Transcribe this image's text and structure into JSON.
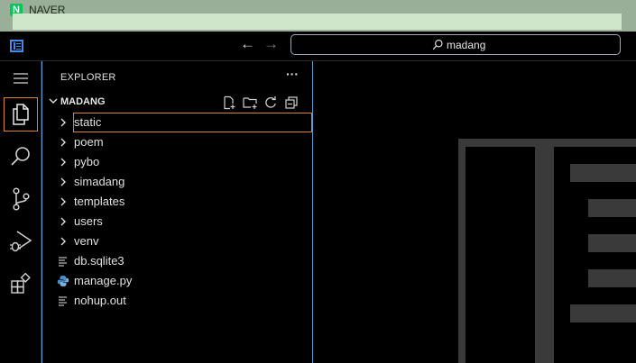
{
  "browser": {
    "logo_letter": "N",
    "title": "NAVER"
  },
  "titlebar": {
    "search_text": "madang",
    "back_icon": "arrow-left-icon",
    "forward_icon": "arrow-right-icon"
  },
  "activity_bar": {
    "items": [
      {
        "name": "menu",
        "icon": "hamburger-menu-icon"
      },
      {
        "name": "explorer",
        "icon": "files-icon",
        "active": true
      },
      {
        "name": "search",
        "icon": "search-icon"
      },
      {
        "name": "source-control",
        "icon": "source-control-icon"
      },
      {
        "name": "run-and-debug",
        "icon": "run-debug-icon"
      },
      {
        "name": "extensions",
        "icon": "extensions-icon"
      }
    ]
  },
  "sidebar": {
    "title": "EXPLORER",
    "more": "···",
    "folder_name": "MADANG",
    "items": [
      {
        "label": "static",
        "type": "folder",
        "focused": true
      },
      {
        "label": "poem",
        "type": "folder"
      },
      {
        "label": "pybo",
        "type": "folder"
      },
      {
        "label": "simadang",
        "type": "folder"
      },
      {
        "label": "templates",
        "type": "folder"
      },
      {
        "label": "users",
        "type": "folder"
      },
      {
        "label": "venv",
        "type": "folder"
      },
      {
        "label": "db.sqlite3",
        "type": "file",
        "icon": "lines-file-icon"
      },
      {
        "label": "manage.py",
        "type": "file",
        "icon": "python-icon"
      },
      {
        "label": "nohup.out",
        "type": "file",
        "icon": "lines-file-icon"
      }
    ]
  },
  "colors": {
    "accent_border": "#d9822b",
    "sidebar_border": "#5a9fd4",
    "app_icon": "#3b8eea",
    "browser_bar": "#9aaf97"
  }
}
